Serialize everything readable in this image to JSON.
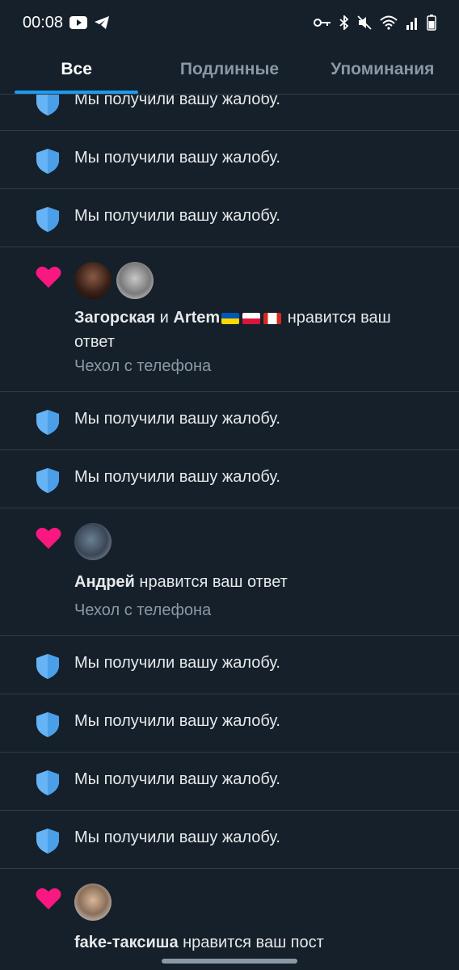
{
  "status_bar": {
    "time": "00:08",
    "icons": [
      "youtube-icon",
      "telegram-icon",
      "key-icon",
      "bluetooth-icon",
      "mute-icon",
      "wifi-icon",
      "signal-icon",
      "battery-icon"
    ]
  },
  "tabs": [
    {
      "label": "Все",
      "active": true
    },
    {
      "label": "Подлинные",
      "active": false
    },
    {
      "label": "Упоминания",
      "active": false
    }
  ],
  "report_text": "Мы получили вашу жалобу.",
  "likes": [
    {
      "user1": "Загорская",
      "connector": " и ",
      "user2": "Artem",
      "action": " нравится ваш ответ",
      "subtitle": "Чехол с телефона"
    },
    {
      "user1": "Андрей",
      "action": " нравится ваш ответ",
      "subtitle": "Чехол с телефона"
    },
    {
      "user1": "fake-таксиша",
      "action": " нравится ваш пост"
    }
  ],
  "colors": {
    "background": "#15202b",
    "accent": "#1d9bf0",
    "heart": "#f91880",
    "shield": "#66b3f5"
  }
}
